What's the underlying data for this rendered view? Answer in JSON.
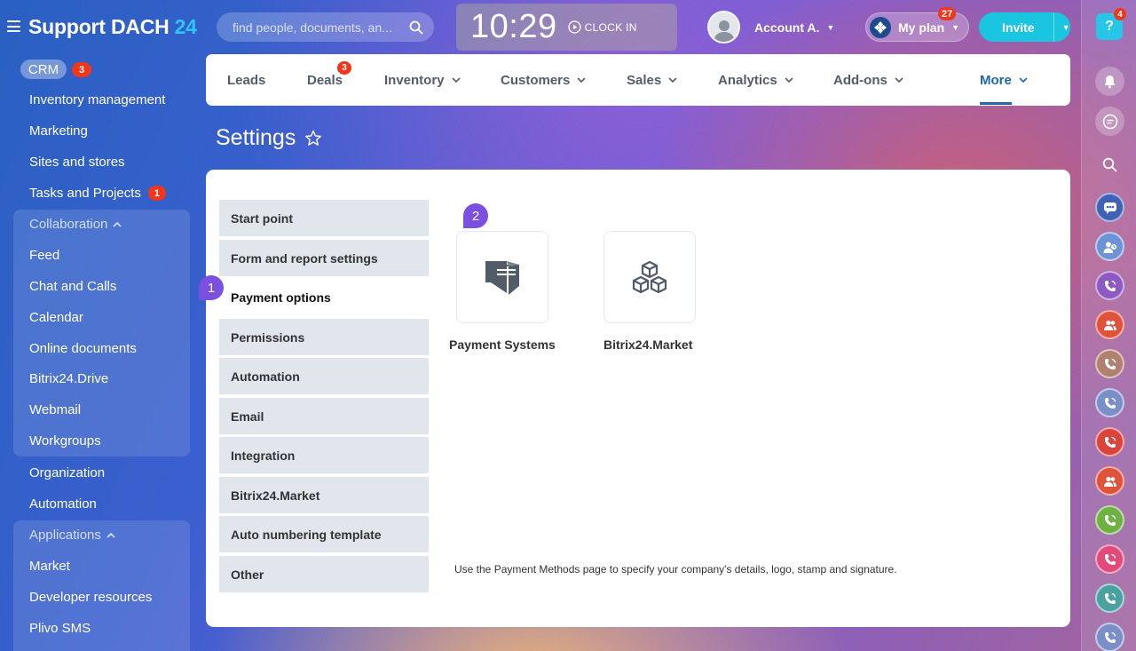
{
  "header": {
    "brand": "Support DACH",
    "brand_number": "24",
    "search_placeholder": "find people, documents, an...",
    "clock_time": "10:29",
    "clock_in_label": "CLOCK IN",
    "account_name": "Account A.",
    "my_plan_label": "My plan",
    "my_plan_badge": "27",
    "invite_label": "Invite"
  },
  "sidebar": {
    "crm_label": "CRM",
    "crm_badge": "3",
    "items": [
      {
        "label": "Inventory management"
      },
      {
        "label": "Marketing"
      },
      {
        "label": "Sites and stores"
      },
      {
        "label": "Tasks and Projects",
        "badge": "1"
      }
    ],
    "collaboration_title": "Collaboration",
    "collaboration_items": [
      {
        "label": "Feed"
      },
      {
        "label": "Chat and Calls"
      },
      {
        "label": "Calendar"
      },
      {
        "label": "Online documents"
      },
      {
        "label": "Bitrix24.Drive"
      },
      {
        "label": "Webmail"
      },
      {
        "label": "Workgroups"
      }
    ],
    "items_after": [
      {
        "label": "Organization"
      },
      {
        "label": "Automation"
      }
    ],
    "applications_title": "Applications",
    "applications_items": [
      {
        "label": "Market"
      },
      {
        "label": "Developer resources"
      },
      {
        "label": "Plivo SMS"
      }
    ]
  },
  "topnav": {
    "items": [
      {
        "label": "Leads"
      },
      {
        "label": "Deals",
        "badge": "3"
      },
      {
        "label": "Inventory"
      },
      {
        "label": "Customers"
      },
      {
        "label": "Sales"
      },
      {
        "label": "Analytics"
      },
      {
        "label": "Add-ons"
      },
      {
        "label": "More"
      }
    ]
  },
  "page": {
    "title": "Settings"
  },
  "settings": {
    "menu": [
      {
        "label": "Start point"
      },
      {
        "label": "Form and report settings"
      },
      {
        "label": "Payment options",
        "active": true
      },
      {
        "label": "Permissions"
      },
      {
        "label": "Automation"
      },
      {
        "label": "Email"
      },
      {
        "label": "Integration"
      },
      {
        "label": "Bitrix24.Market"
      },
      {
        "label": "Auto numbering template"
      },
      {
        "label": "Other"
      }
    ],
    "step1": "1",
    "step2": "2",
    "tiles": [
      {
        "label": "Payment Systems",
        "icon": "payment-systems-icon"
      },
      {
        "label": "Bitrix24.Market",
        "icon": "cubes-icon"
      }
    ],
    "hint": "Use the Payment Methods page to specify your company's details, logo, stamp and signature."
  },
  "rightbar": {
    "help_badge": "4",
    "contacts": [
      {
        "icon": "group-chat-icon",
        "color": "#3f62b5"
      },
      {
        "icon": "user-clock-icon",
        "color": "#6b93d6"
      },
      {
        "icon": "phone-icon",
        "color": "#8d5ac3"
      },
      {
        "icon": "users-icon",
        "color": "#e0533a"
      },
      {
        "icon": "phone-icon",
        "color": "#b08070"
      },
      {
        "icon": "phone-icon",
        "color": "#7a8fc8"
      },
      {
        "icon": "phone-icon",
        "color": "#d9453c"
      },
      {
        "icon": "users-icon",
        "color": "#e0533a"
      },
      {
        "icon": "phone-icon",
        "color": "#6fb142"
      },
      {
        "icon": "phone-icon",
        "color": "#e24a7c"
      },
      {
        "icon": "phone-icon",
        "color": "#4aa2a0"
      },
      {
        "icon": "phone-icon",
        "color": "#7a8fc8"
      }
    ]
  }
}
